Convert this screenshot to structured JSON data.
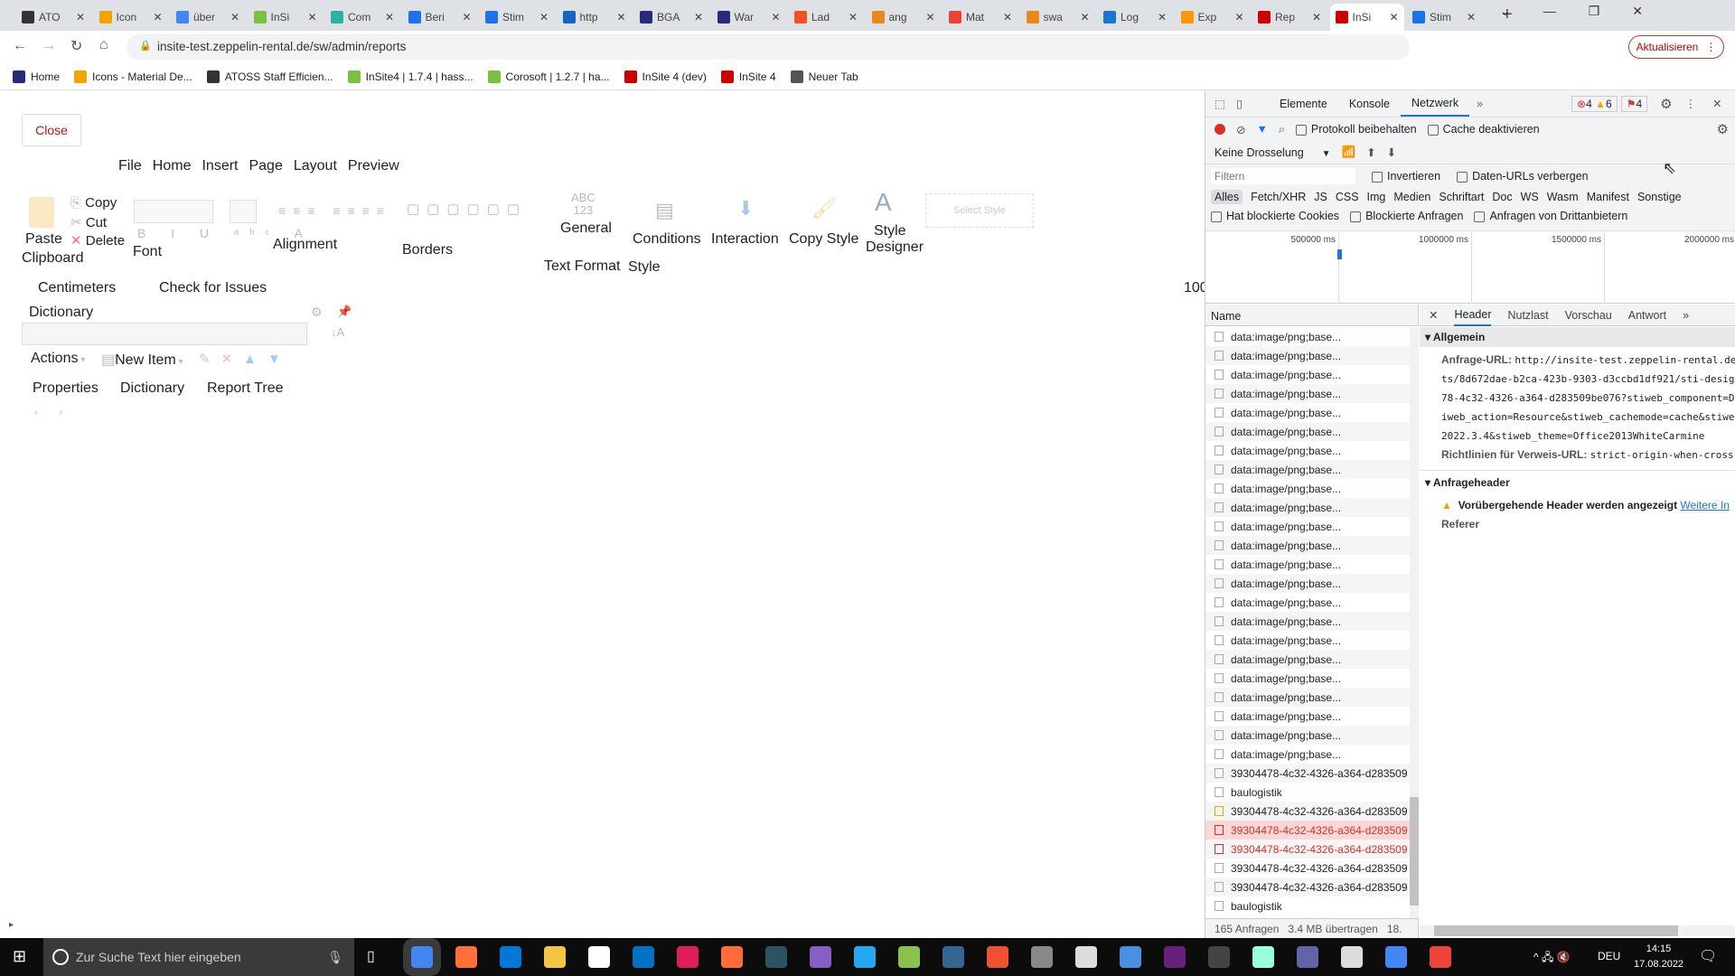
{
  "browser": {
    "tabs": [
      "ATO",
      "Icon",
      "über",
      "InSi",
      "Com",
      "Beri",
      "Stim",
      "http",
      "BGA",
      "War",
      "Lad",
      "ang",
      "Mat",
      "swa",
      "Log",
      "Exp",
      "Rep",
      "InSi",
      "Stim"
    ],
    "active_tab": 17,
    "tab_colors": [
      "#333",
      "#f4a400",
      "#4285f4",
      "#7ac143",
      "#2bb3a0",
      "#1a73e8",
      "#1a73e8",
      "#1565c0",
      "#2a2a7a",
      "#2a2a7a",
      "#f25022",
      "#e8891b",
      "#ea4335",
      "#e8891b",
      "#1976d2",
      "#ff9800",
      "#c00",
      "#c00",
      "#1a73e8"
    ],
    "url": "insite-test.zeppelin-rental.de/sw/admin/reports",
    "update_button": "Aktualisieren",
    "bookmarks": [
      "Home",
      "Icons - Material De...",
      "ATOSS Staff Efficien...",
      "InSite4 | 1.7.4 | hass...",
      "Corosoft | 1.2.7 | ha...",
      "InSite 4 (dev)",
      "InSite 4",
      "Neuer Tab"
    ]
  },
  "designer": {
    "close": "Close",
    "menu": [
      "File",
      "Home",
      "Insert",
      "Page",
      "Layout",
      "Preview"
    ],
    "ribbon": {
      "copy": "Copy",
      "cut": "Cut",
      "delete": "Delete",
      "paste": "Paste",
      "clipboard": "Clipboard",
      "font": "Font",
      "alignment": "Alignment",
      "borders": "Borders",
      "abc": "ABC",
      "num": "123",
      "general": "General",
      "text_format": "Text Format",
      "conditions": "Conditions",
      "interaction": "Interaction",
      "copy_style": "Copy Style",
      "style_designer_1": "Style",
      "style_designer_2": "Designer",
      "select_style": "Select Style",
      "style": "Style"
    },
    "units": "Centimeters",
    "check": "Check for Issues",
    "zoom": "100",
    "dictionary": "Dictionary",
    "actions": "Actions",
    "new_item": "New Item",
    "panel_tabs": [
      "Properties",
      "Dictionary",
      "Report Tree"
    ]
  },
  "devtools": {
    "tabs": [
      "Elemente",
      "Konsole",
      "Netzwerk"
    ],
    "active_tab": "Netzwerk",
    "errors": "4",
    "warnings": "6",
    "issues": "4",
    "preserve_log": "Protokoll beibehalten",
    "disable_cache": "Cache deaktivieren",
    "throttle": "Keine Drosselung",
    "filter_placeholder": "Filtern",
    "invert": "Invertieren",
    "hide_data_urls": "Daten-URLs verbergen",
    "types": [
      "Alles",
      "Fetch/XHR",
      "JS",
      "CSS",
      "Img",
      "Medien",
      "Schriftart",
      "Doc",
      "WS",
      "Wasm",
      "Manifest",
      "Sonstige"
    ],
    "blocked_cookies": "Hat blockierte Cookies",
    "blocked_requests": "Blockierte Anfragen",
    "third_party": "Anfragen von Drittanbietern",
    "timeline_ticks": [
      "500000 ms",
      "1000000 ms",
      "1500000 ms",
      "2000000 ms"
    ],
    "name_header": "Name",
    "requests": [
      {
        "name": "data:image/png;base...",
        "status": "normal"
      },
      {
        "name": "data:image/png;base...",
        "status": "normal"
      },
      {
        "name": "data:image/png;base...",
        "status": "normal"
      },
      {
        "name": "data:image/png;base...",
        "status": "normal"
      },
      {
        "name": "data:image/png;base...",
        "status": "normal"
      },
      {
        "name": "data:image/png;base...",
        "status": "normal"
      },
      {
        "name": "data:image/png;base...",
        "status": "normal"
      },
      {
        "name": "data:image/png;base...",
        "status": "normal"
      },
      {
        "name": "data:image/png;base...",
        "status": "normal"
      },
      {
        "name": "data:image/png;base...",
        "status": "normal"
      },
      {
        "name": "data:image/png;base...",
        "status": "normal"
      },
      {
        "name": "data:image/png;base...",
        "status": "normal"
      },
      {
        "name": "data:image/png;base...",
        "status": "normal"
      },
      {
        "name": "data:image/png;base...",
        "status": "normal"
      },
      {
        "name": "data:image/png;base...",
        "status": "normal"
      },
      {
        "name": "data:image/png;base...",
        "status": "normal"
      },
      {
        "name": "data:image/png;base...",
        "status": "normal"
      },
      {
        "name": "data:image/png;base...",
        "status": "normal"
      },
      {
        "name": "data:image/png;base...",
        "status": "normal"
      },
      {
        "name": "data:image/png;base...",
        "status": "normal"
      },
      {
        "name": "data:image/png;base...",
        "status": "normal"
      },
      {
        "name": "data:image/png;base...",
        "status": "normal"
      },
      {
        "name": "data:image/png;base...",
        "status": "normal"
      },
      {
        "name": "39304478-4c32-4326-a364-d283509",
        "status": "normal"
      },
      {
        "name": "baulogistik",
        "status": "normal"
      },
      {
        "name": "39304478-4c32-4326-a364-d283509",
        "status": "normal"
      },
      {
        "name": "39304478-4c32-4326-a364-d283509",
        "status": "selected-error"
      },
      {
        "name": "39304478-4c32-4326-a364-d283509",
        "status": "error"
      },
      {
        "name": "39304478-4c32-4326-a364-d283509",
        "status": "normal"
      },
      {
        "name": "39304478-4c32-4326-a364-d283509",
        "status": "normal"
      },
      {
        "name": "baulogistik",
        "status": "normal"
      }
    ],
    "detail_tabs": [
      "Header",
      "Nutzlast",
      "Vorschau",
      "Antwort"
    ],
    "general": "Allgemein",
    "request_url_label": "Anfrage-URL:",
    "request_url_lines": [
      "http://insite-test.zeppelin-rental.de",
      "ts/8d672dae-b2ca-423b-9303-d3ccbd1df921/sti-desig",
      "78-4c32-4326-a364-d283509be076?stiweb_component=D",
      "iweb_action=Resource&stiweb_cachemode=cache&stiwe",
      "2022.3.4&stiweb_theme=Office2013WhiteCarmine"
    ],
    "referrer_policy_label": "Richtlinien für Verweis-URL:",
    "referrer_policy": "strict-origin-when-cross",
    "request_headers": "Anfrageheader",
    "provisional": "Vorübergehende Header werden angezeigt",
    "more_info": "Weitere In",
    "referer": "Referer",
    "status": [
      "165 Anfragen",
      "3.4 MB übertragen",
      "18."
    ]
  },
  "taskbar": {
    "search_placeholder": "Zur Suche Text hier eingeben",
    "time": "14:15",
    "date": "17.08.2022",
    "lang": "DEU",
    "apps": [
      "chrome",
      "firefox",
      "edge",
      "explorer",
      "app",
      "outlook",
      "slack",
      "postman",
      "terminal",
      "visual-studio",
      "vscode",
      "notepad",
      "pgadmin",
      "git",
      "app",
      "tool",
      "app",
      "visual-studio",
      "cmd",
      "app",
      "teams",
      "app",
      "chrome",
      "anydesk"
    ],
    "app_colors": [
      "#4285f4",
      "#ff7139",
      "#0078d7",
      "#f4c542",
      "#fff",
      "#0072c6",
      "#e01e5a",
      "#ff6c37",
      "#2c5364",
      "#865fc5",
      "#23a9f2",
      "#8bc34a",
      "#336791",
      "#f05033",
      "#888",
      "#ddd",
      "#4a90e2",
      "#68217a",
      "#444",
      "#9fd",
      "#6264a7",
      "#ddd",
      "#4285f4",
      "#ef443b"
    ]
  }
}
